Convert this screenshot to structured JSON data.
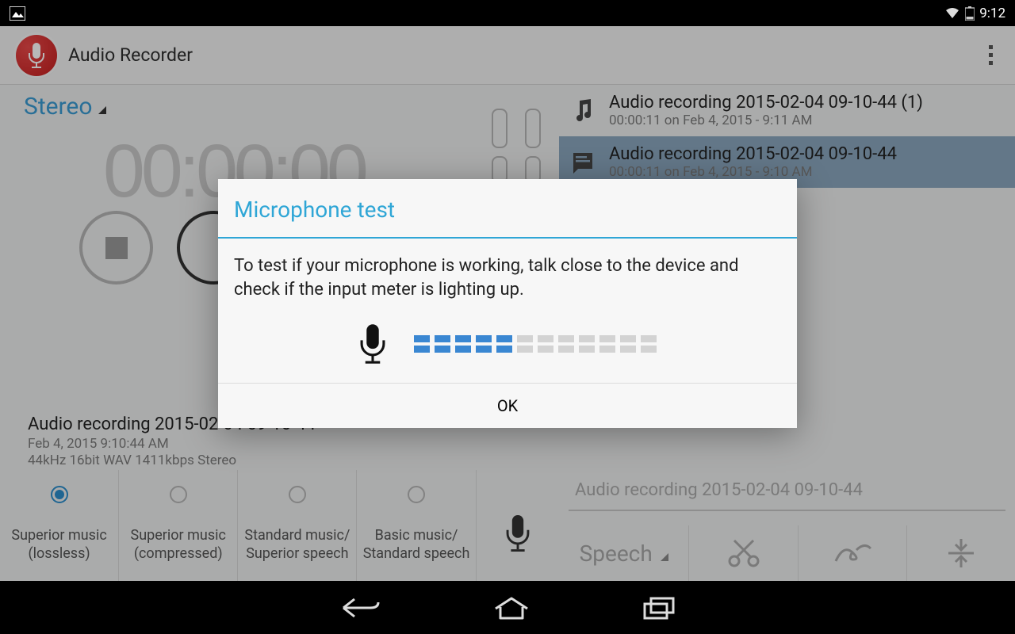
{
  "status_bar": {
    "time": "9:12"
  },
  "action_bar": {
    "title": "Audio Recorder"
  },
  "left_panel": {
    "mode_label": "Stereo",
    "timer": "00:00:00",
    "current_recording": {
      "name": "Audio recording 2015-02-04 09-10-44",
      "date": "Feb 4, 2015 9:10:44 AM",
      "format": "44kHz 16bit WAV 1411kbps Stereo"
    },
    "quality_options": [
      "Superior music\n(lossless)",
      "Superior music\n(compressed)",
      "Standard music/\nSuperior speech",
      "Basic music/\nStandard speech"
    ],
    "selected_quality": 0
  },
  "recordings": [
    {
      "title": "Audio recording 2015-02-04 09-10-44 (1)",
      "meta": "00:00:11 on Feb 4, 2015 - 9:11 AM",
      "selected": false
    },
    {
      "title": "Audio recording 2015-02-04 09-10-44",
      "meta": "00:00:11 on Feb 4, 2015 - 9:10 AM",
      "selected": true
    }
  ],
  "bottom_tools": {
    "filename": "Audio recording 2015-02-04 09-10-44",
    "speech_label": "Speech"
  },
  "dialog": {
    "title": "Microphone test",
    "body": "To test if your microphone is working, talk close to the device and check if the input meter is lighting up.",
    "meter_level": 5,
    "meter_total": 12,
    "ok": "OK"
  }
}
